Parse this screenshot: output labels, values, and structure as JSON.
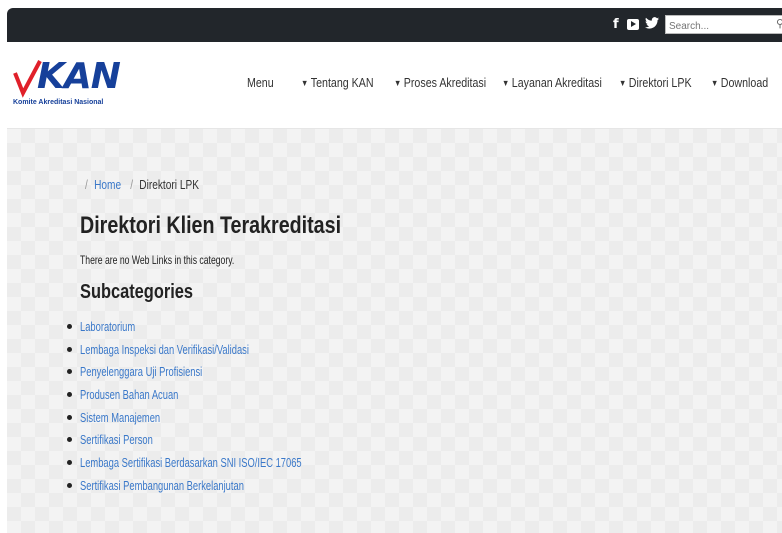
{
  "topbar": {
    "social": [
      "facebook-icon",
      "youtube-icon",
      "twitter-icon"
    ],
    "search_placeholder": "Search..."
  },
  "logo": {
    "text": "KAN",
    "subtitle": "Komite Akreditasi Nasional"
  },
  "nav": {
    "items": [
      {
        "label": "Menu",
        "has_caret": false
      },
      {
        "label": "Tentang KAN",
        "has_caret": true
      },
      {
        "label": "Proses Akreditasi",
        "has_caret": true
      },
      {
        "label": "Layanan Akreditasi",
        "has_caret": true
      },
      {
        "label": "Direktori LPK",
        "has_caret": true
      },
      {
        "label": "Download",
        "has_caret": true
      }
    ]
  },
  "breadcrumb": {
    "home": "Home",
    "current": "Direktori LPK"
  },
  "main": {
    "title": "Direktori Klien Terakreditasi",
    "empty_message": "There are no Web Links in this category.",
    "subcategories_title": "Subcategories",
    "subcategories": [
      "Laboratorium",
      "Lembaga Inspeksi dan Verifikasi/Validasi",
      "Penyelenggara Uji Profisiensi",
      "Produsen Bahan Acuan",
      "Sistem Manajemen",
      "Sertifikasi Person",
      "Lembaga Sertifikasi Berdasarkan SNI ISO/IEC 17065",
      "Sertifikasi Pembangunan Berkelanjutan"
    ]
  },
  "colors": {
    "topbar": "#22262b",
    "brand_blue": "#16409a",
    "brand_red": "#e0202a",
    "link": "#3a78c9"
  }
}
